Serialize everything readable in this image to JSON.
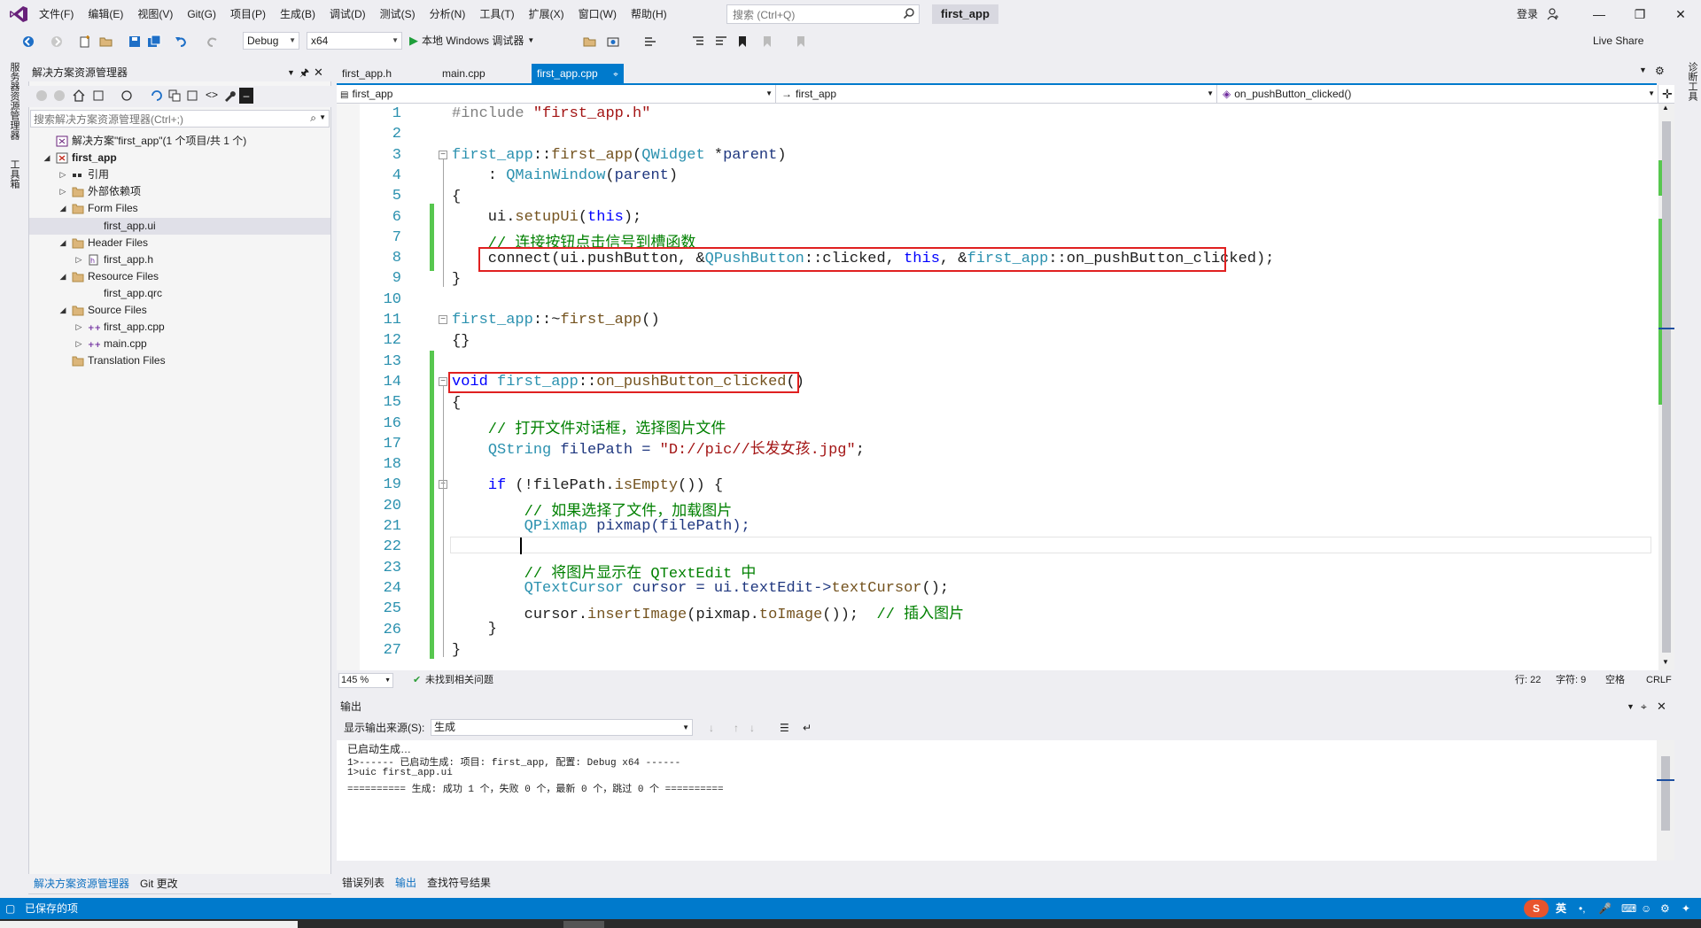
{
  "menubar": {
    "items": [
      "文件(F)",
      "编辑(E)",
      "视图(V)",
      "Git(G)",
      "项目(P)",
      "生成(B)",
      "调试(D)",
      "测试(S)",
      "分析(N)",
      "工具(T)",
      "扩展(X)",
      "窗口(W)",
      "帮助(H)"
    ]
  },
  "search": {
    "placeholder": "搜索 (Ctrl+Q)"
  },
  "solution_name": "first_app",
  "login": "登录",
  "toolbar": {
    "config": "Debug",
    "platform": "x64",
    "run_label": "本地 Windows 调试器",
    "liveshare": "Live Share"
  },
  "left_strip": {
    "server_explorer": "服务器资源管理器",
    "toolbox": "工具箱"
  },
  "right_strip": {
    "diagnostics": "诊断工具"
  },
  "solution_explorer": {
    "title": "解决方案资源管理器",
    "search_placeholder": "搜索解决方案资源管理器(Ctrl+;)",
    "tree": [
      {
        "label": "解决方案\"first_app\"(1 个项目/共 1 个)",
        "level": 0,
        "arrow": "",
        "icon": "solution-icon"
      },
      {
        "label": "first_app",
        "level": 0,
        "arrow": "expanded",
        "icon": "project-icon",
        "bold": true
      },
      {
        "label": "引用",
        "level": 1,
        "arrow": "collapsed",
        "icon": "references-icon"
      },
      {
        "label": "外部依赖项",
        "level": 1,
        "arrow": "collapsed",
        "icon": "folder-icon"
      },
      {
        "label": "Form Files",
        "level": 1,
        "arrow": "expanded",
        "icon": "folder-icon"
      },
      {
        "label": "first_app.ui",
        "level": 2,
        "arrow": "",
        "icon": "",
        "selected": true
      },
      {
        "label": "Header Files",
        "level": 1,
        "arrow": "expanded",
        "icon": "folder-icon"
      },
      {
        "label": "first_app.h",
        "level": 2,
        "arrow": "collapsed",
        "icon": "header-file-icon"
      },
      {
        "label": "Resource Files",
        "level": 1,
        "arrow": "expanded",
        "icon": "folder-icon"
      },
      {
        "label": "first_app.qrc",
        "level": 2,
        "arrow": "",
        "icon": ""
      },
      {
        "label": "Source Files",
        "level": 1,
        "arrow": "expanded",
        "icon": "folder-icon"
      },
      {
        "label": "first_app.cpp",
        "level": 2,
        "arrow": "collapsed",
        "icon": "cpp-file-icon"
      },
      {
        "label": "main.cpp",
        "level": 2,
        "arrow": "collapsed",
        "icon": "cpp-file-icon"
      },
      {
        "label": "Translation Files",
        "level": 1,
        "arrow": "",
        "icon": "folder-icon"
      }
    ],
    "bottom_tabs": [
      "解决方案资源管理器",
      "Git 更改"
    ]
  },
  "doc_tabs": [
    {
      "label": "first_app.h",
      "active": false
    },
    {
      "label": "main.cpp",
      "active": false
    },
    {
      "label": "first_app.cpp",
      "active": true
    }
  ],
  "navbar": {
    "project": "first_app",
    "scope": "first_app",
    "member": "on_pushButton_clicked()"
  },
  "code_lines": [
    "1",
    "2",
    "3",
    "4",
    "5",
    "6",
    "7",
    "8",
    "9",
    "10",
    "11",
    "12",
    "13",
    "14",
    "15",
    "16",
    "17",
    "18",
    "19",
    "20",
    "21",
    "22",
    "23",
    "24",
    "25",
    "26",
    "27"
  ],
  "code": {
    "l1_a": "#include ",
    "l1_b": "\"first_app.h\"",
    "l3_a": "first_app",
    "l3_b": "::",
    "l3_c": "first_app",
    "l3_d": "(",
    "l3_e": "QWidget",
    "l3_f": " *",
    "l3_g": "parent",
    "l3_h": ")",
    "l4_a": "    : ",
    "l4_b": "QMainWindow",
    "l4_c": "(",
    "l4_d": "parent",
    "l4_e": ")",
    "l5": "{",
    "l6_a": "    ui.",
    "l6_b": "setupUi",
    "l6_c": "(",
    "l6_d": "this",
    "l6_e": ");",
    "l7": "    // 连接按钮点击信号到槽函数",
    "l8_a": "    connect(ui.pushButton, &",
    "l8_b": "QPushButton",
    "l8_c": "::clicked, ",
    "l8_d": "this",
    "l8_e": ", &",
    "l8_f": "first_app",
    "l8_g": "::on_pushButton_clicked);",
    "l9": "}",
    "l11_a": "first_app",
    "l11_b": "::~",
    "l11_c": "first_app",
    "l11_d": "()",
    "l12": "{}",
    "l14_a": "void ",
    "l14_b": "first_app",
    "l14_c": "::",
    "l14_d": "on_pushButton_clicked",
    "l14_e": "()",
    "l15": "{",
    "l16": "    // 打开文件对话框，选择图片文件",
    "l17_a": "    ",
    "l17_b": "QString",
    "l17_c": " filePath = ",
    "l17_d": "\"D://pic//长发女孩.jpg\"",
    "l17_e": ";",
    "l19_a": "    ",
    "l19_b": "if",
    "l19_c": " (!filePath.",
    "l19_d": "isEmpty",
    "l19_e": "()) {",
    "l20": "        // 如果选择了文件，加载图片",
    "l21_a": "        ",
    "l21_b": "QPixmap",
    "l21_c": " pixmap(filePath);",
    "l23": "        // 将图片显示在 QTextEdit 中",
    "l24_a": "        ",
    "l24_b": "QTextCursor",
    "l24_c": " cursor = ui.textEdit->",
    "l24_d": "textCursor",
    "l24_e": "();",
    "l25_a": "        cursor.",
    "l25_b": "insertImage",
    "l25_c": "(pixmap.",
    "l25_d": "toImage",
    "l25_e": "());  ",
    "l25_f": "// 插入图片",
    "l26": "    }",
    "l27": "}"
  },
  "editor_status": {
    "zoom": "145 %",
    "issues": "未找到相关问题",
    "line": "行: 22",
    "char": "字符: 9",
    "spaces": "空格",
    "eol": "CRLF"
  },
  "output": {
    "title": "输出",
    "source_label": "显示输出来源(S):",
    "source_value": "生成",
    "lines": [
      "已启动生成…",
      "1>------ 已启动生成: 项目: first_app, 配置: Debug x64 ------",
      "1>uic first_app.ui",
      "========== 生成: 成功 1 个，失败 0 个，最新 0 个，跳过 0 个 =========="
    ],
    "bottom_tabs": [
      "错误列表",
      "输出",
      "查找符号结果"
    ]
  },
  "statusbar": {
    "text": "已保存的项",
    "ime": "英"
  },
  "colors": {
    "accent": "#007acc",
    "selection": "#cce4f7",
    "highlight_box": "#e02020",
    "change_bar": "#57c74f"
  }
}
